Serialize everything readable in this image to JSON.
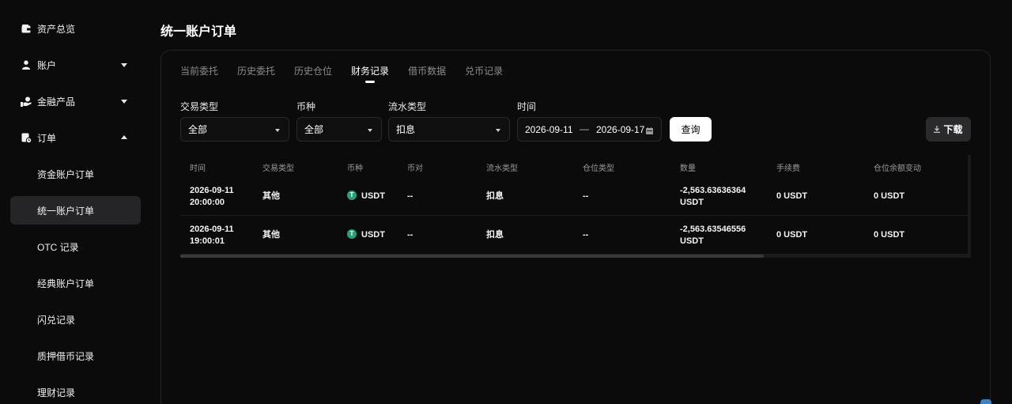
{
  "sidebar": {
    "items": [
      {
        "label": "资产总览",
        "icon": "wallet-icon"
      },
      {
        "label": "账户",
        "icon": "user-icon",
        "caret": "down"
      },
      {
        "label": "金融产品",
        "icon": "finance-icon",
        "caret": "down"
      },
      {
        "label": "订单",
        "icon": "order-icon",
        "caret": "up"
      }
    ],
    "sub_items": [
      "资金账户订单",
      "统一账户订单",
      "OTC 记录",
      "经典账户订单",
      "闪兑记录",
      "质押借币记录",
      "理财记录"
    ],
    "active_sub": "统一账户订单"
  },
  "page": {
    "title": "统一账户订单"
  },
  "tabs": [
    "当前委托",
    "历史委托",
    "历史仓位",
    "财务记录",
    "借币数据",
    "兑币记录"
  ],
  "active_tab": "财务记录",
  "filters": {
    "trade_type": {
      "label": "交易类型",
      "value": "全部"
    },
    "currency": {
      "label": "币种",
      "value": "全部"
    },
    "flow_type": {
      "label": "流水类型",
      "value": "扣息"
    },
    "time": {
      "label": "时间",
      "start": "2026-09-11",
      "separator": "—",
      "end": "2026-09-17"
    },
    "query_label": "查询",
    "download_label": "下载"
  },
  "table": {
    "headers": [
      "时间",
      "交易类型",
      "币种",
      "币对",
      "流水类型",
      "仓位类型",
      "数量",
      "手续费",
      "仓位余额变动"
    ],
    "rows": [
      {
        "date": "2026-09-11",
        "time": "20:00:00",
        "trade_type": "其他",
        "currency": "USDT",
        "pair": "--",
        "flow_type": "扣息",
        "position_type": "--",
        "amount": "-2,563.63636364",
        "amount_unit": "USDT",
        "fee": "0 USDT",
        "balance_change": "0 USDT"
      },
      {
        "date": "2026-09-11",
        "time": "19:00:01",
        "trade_type": "其他",
        "currency": "USDT",
        "pair": "--",
        "flow_type": "扣息",
        "position_type": "--",
        "amount": "-2,563.63546556",
        "amount_unit": "USDT",
        "fee": "0 USDT",
        "balance_change": "0 USDT"
      }
    ]
  },
  "colors": {
    "background": "#0b0b0b",
    "active_nav": "#252527",
    "usdt": "#27a17c"
  }
}
